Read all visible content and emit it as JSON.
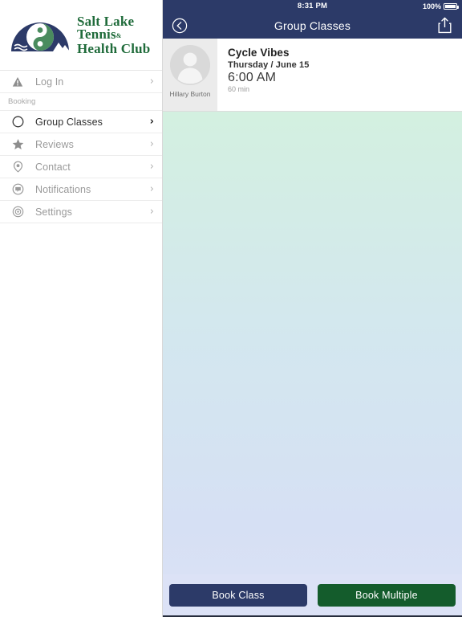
{
  "sidebar": {
    "brand": {
      "line1": "Salt Lake",
      "line2": "Tennis",
      "amp": "&",
      "line3": "Health Club",
      "logo_icon": "dome-yin-yang-logo",
      "green": "#1f6b3a",
      "navy": "#2c3a68"
    },
    "items": [
      {
        "label": "Log In",
        "icon": "warning-triangle-icon",
        "active": false,
        "chevron": "›"
      },
      {
        "label": "Group Classes",
        "icon": "circle-icon",
        "active": true,
        "chevron": "›"
      },
      {
        "label": "Reviews",
        "icon": "star-icon",
        "active": false,
        "chevron": "›"
      },
      {
        "label": "Contact",
        "icon": "location-pin-icon",
        "active": false,
        "chevron": "›"
      },
      {
        "label": "Notifications",
        "icon": "speech-bubble-icon",
        "active": false,
        "chevron": "›"
      },
      {
        "label": "Settings",
        "icon": "gear-icon",
        "active": false,
        "chevron": "›"
      }
    ],
    "section_header": "Booking"
  },
  "statusbar": {
    "time": "8:31 PM",
    "battery_percent": "100%",
    "battery_icon": "battery-full-icon"
  },
  "navbar": {
    "title": "Group Classes",
    "back_icon": "back-chevron-circle-icon",
    "share_icon": "share-icon",
    "background": "#2c3a68"
  },
  "class_card": {
    "instructor": "Hillary Burton",
    "avatar_icon": "user-silhouette-avatar",
    "name": "Cycle Vibes",
    "date": "Thursday / June 15",
    "time": "6:00 AM",
    "duration": "60 min"
  },
  "actions": {
    "book_class": "Book Class",
    "book_multiple": "Book Multiple",
    "book_class_color": "#2c3a68",
    "book_multiple_color": "#145c2c"
  },
  "background": {
    "gradient_top": "#d3f0e0",
    "gradient_mid": "#d3e7ef",
    "gradient_bottom": "#dce2f6"
  }
}
